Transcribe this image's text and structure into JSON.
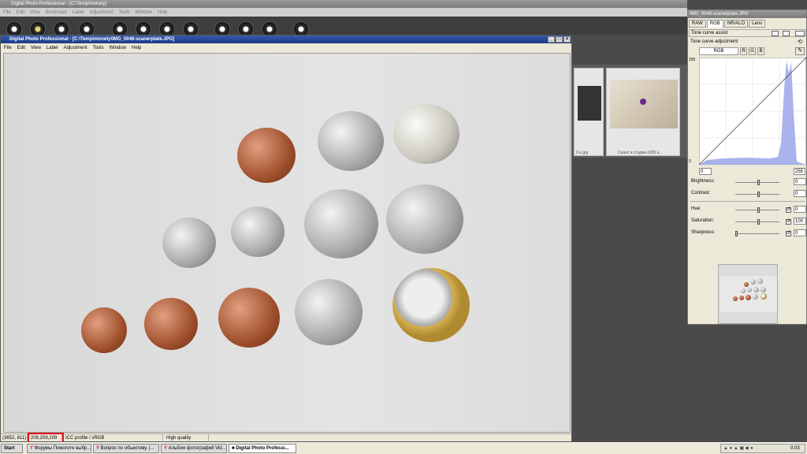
{
  "main_window": {
    "title": "Digital Photo Professional - [C:\\Temp\\monety]",
    "menu": [
      "File",
      "Edit",
      "View",
      "Bookmark",
      "Label",
      "Adjustment",
      "Tools",
      "Window",
      "Help"
    ]
  },
  "image_window": {
    "title": "Digital Photo Professional - [C:\\Temp\\monety\\IMG_0048-scanerplate.JPG]",
    "menu": [
      "File",
      "Edit",
      "View",
      "Label",
      "Adjustment",
      "Tools",
      "Window",
      "Help"
    ]
  },
  "status": {
    "coords": "(3652, 811)",
    "rgb": "209,209,209",
    "profile": "ICC profile / sRGB",
    "quality": "High quality"
  },
  "thumbnails": [
    {
      "caption": "0-o.jpg"
    },
    {
      "caption": "Сеанс в студии-1095 к..."
    }
  ],
  "tool_palette": {
    "title": "IMG_0048-scanerplate.JPG",
    "tabs": [
      "RAW",
      "RGB",
      "NR/ALO",
      "Lens"
    ],
    "tone_curve_assist": "Tone curve assist",
    "tone_curve_adjustment": "Tone curve adjustment",
    "channel_tabs": [
      "RGB",
      "R",
      "G",
      "B"
    ],
    "axis_max": "255",
    "axis_min": "0",
    "input_min": "0",
    "input_max": "255",
    "brightness": {
      "label": "Brightness:",
      "value": "0"
    },
    "contrast": {
      "label": "Contrast:",
      "value": "0"
    },
    "hue": {
      "label": "Hue:",
      "value": "0"
    },
    "saturation": {
      "label": "Saturation:",
      "value": "100"
    },
    "sharpness": {
      "label": "Sharpness:",
      "value": "0"
    }
  },
  "taskbar": {
    "start": "Start",
    "items": [
      "Форумы Помогите выбр...",
      "Вопрос по объективу. |...",
      "Альбом фотографий Vid...",
      "Digital Photo Professi..."
    ],
    "clock": "0:03"
  },
  "colors": {
    "accent_blue": "#1a3a8a",
    "highlight_red": "#e0141e",
    "histogram": "#9aa4e8"
  }
}
